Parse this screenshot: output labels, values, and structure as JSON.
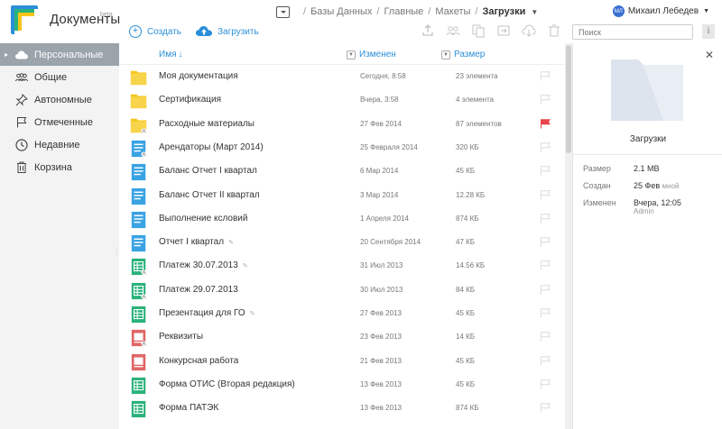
{
  "app": {
    "title": "Документы",
    "badge": "beta"
  },
  "breadcrumb": {
    "items": [
      "Базы Данных",
      "Главные",
      "Макеты"
    ],
    "separator": "/",
    "current": "Загрузки"
  },
  "user": {
    "initials": "МЛ",
    "name": "Михаил Лебедев"
  },
  "actions": {
    "create": "Создать",
    "upload": "Загрузить"
  },
  "toolbar_icons": [
    "share-icon",
    "users-icon",
    "copy-icon",
    "move-icon",
    "download-icon",
    "delete-icon"
  ],
  "search": {
    "placeholder": "Поиск"
  },
  "info_button": "i",
  "sidebar": {
    "items": [
      {
        "label": "Персональные",
        "icon": "cloud-icon",
        "active": true
      },
      {
        "label": "Общие",
        "icon": "people-icon",
        "active": false
      },
      {
        "label": "Автономные",
        "icon": "pin-icon",
        "active": false
      },
      {
        "label": "Отмеченные",
        "icon": "flag-icon",
        "active": false
      },
      {
        "label": "Недавние",
        "icon": "clock-icon",
        "active": false
      },
      {
        "label": "Корзина",
        "icon": "trash-icon",
        "active": false
      }
    ]
  },
  "list": {
    "columns": {
      "name": "Имя",
      "modified": "Изменен",
      "size": "Размер"
    },
    "rows": [
      {
        "type": "folder",
        "name": "Моя документация",
        "pinned": false,
        "modified": "Сегодня, 8:58",
        "size": "23 элемента",
        "flagged": false,
        "shared": false
      },
      {
        "type": "folder",
        "name": "Сертификация",
        "pinned": false,
        "modified": "Вчера, 3:58",
        "size": "4 элемента",
        "flagged": false,
        "shared": false
      },
      {
        "type": "folder",
        "name": "Расходные материалы",
        "pinned": false,
        "modified": "27 Фев 2014",
        "size": "87 элементов",
        "flagged": true,
        "shared": true
      },
      {
        "type": "doc",
        "name": "Арендаторы (Март 2014)",
        "pinned": false,
        "modified": "25 Февраля 2014",
        "size": "320 КБ",
        "flagged": false,
        "shared": true
      },
      {
        "type": "doc",
        "name": "Баланс Отчет I квартал",
        "pinned": false,
        "modified": "6 Мар 2014",
        "size": "45 КБ",
        "flagged": false,
        "shared": false
      },
      {
        "type": "doc",
        "name": "Баланс Отчет II квартал",
        "pinned": false,
        "modified": "3 Мар 2014",
        "size": "12.28 КБ",
        "flagged": false,
        "shared": false
      },
      {
        "type": "doc",
        "name": "Выполнение ксловий",
        "pinned": false,
        "modified": "1 Апреля 2014",
        "size": "874 КБ",
        "flagged": false,
        "shared": false
      },
      {
        "type": "doc",
        "name": "Отчет I квартал",
        "pinned": true,
        "modified": "20 Сентября 2014",
        "size": "47 КБ",
        "flagged": false,
        "shared": false
      },
      {
        "type": "sheet",
        "name": "Платеж 30.07.2013",
        "pinned": true,
        "modified": "31 Июл 2013",
        "size": "14.56 КБ",
        "flagged": false,
        "shared": true
      },
      {
        "type": "sheet",
        "name": "Платеж 29.07.2013",
        "pinned": false,
        "modified": "30 Июл 2013",
        "size": "84 КБ",
        "flagged": false,
        "shared": true
      },
      {
        "type": "sheet",
        "name": "Презентация для ГО",
        "pinned": true,
        "modified": "27 Фев 2013",
        "size": "45 КБ",
        "flagged": false,
        "shared": false
      },
      {
        "type": "pres",
        "name": "Реквизиты",
        "pinned": false,
        "modified": "23 Фев 2013",
        "size": "14 КБ",
        "flagged": false,
        "shared": true
      },
      {
        "type": "pres",
        "name": "Конкурсная работа",
        "pinned": false,
        "modified": "21 Фев 2013",
        "size": "45 КБ",
        "flagged": false,
        "shared": false
      },
      {
        "type": "sheet",
        "name": "Форма ОТИС (Вторая редакция)",
        "pinned": false,
        "modified": "13 Фев 2013",
        "size": "45 КБ",
        "flagged": false,
        "shared": false
      },
      {
        "type": "sheet",
        "name": "Форма ПАТЭК",
        "pinned": false,
        "modified": "13 Фев 2013",
        "size": "874 КБ",
        "flagged": false,
        "shared": false
      }
    ]
  },
  "panel": {
    "title": "Загрузки",
    "props": [
      {
        "label": "Размер",
        "value": "2.1 MB",
        "sub": ""
      },
      {
        "label": "Создан",
        "value": "25 Фев",
        "sub_inline": "мной"
      },
      {
        "label": "Изменен",
        "value": "Вчера, 12:05",
        "sub": "Admin"
      }
    ]
  },
  "colors": {
    "accent": "#2a8fd8",
    "folder": "#f5c518",
    "doc": "#3aa3e3",
    "sheet": "#2ab27b",
    "pres": "#e06666",
    "flag_on": "#e8454b",
    "sidebar_active": "#9ba3ab"
  }
}
